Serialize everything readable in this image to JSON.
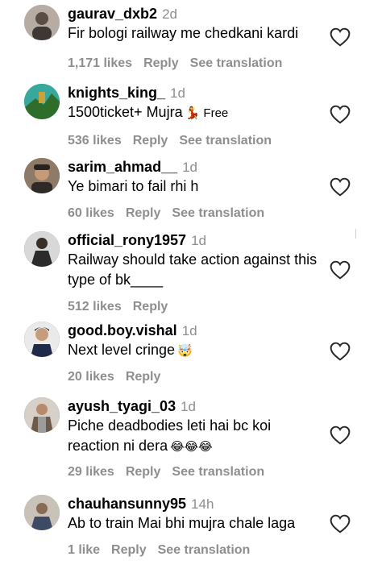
{
  "comments": [
    {
      "username": "gaurav_dxb2",
      "time": "2d",
      "text": "Fir bologi railway me chedkani kardi",
      "emoji": "",
      "likes": "1,171 likes",
      "reply": "Reply",
      "translate": "See translation",
      "avatar_color": "#9a8f86"
    },
    {
      "username": "knights_king_",
      "time": "1d",
      "text": "1500ticket+ Mujra",
      "emoji": "💃 Free",
      "likes": "536 likes",
      "reply": "Reply",
      "translate": "See translation",
      "avatar_color": "#3aa7a0"
    },
    {
      "username": "sarim_ahmad__",
      "time": "1d",
      "text": "Ye bimari to fail rhi h",
      "emoji": "",
      "likes": "60 likes",
      "reply": "Reply",
      "translate": "See translation",
      "avatar_color": "#7a6250"
    },
    {
      "username": "official_rony1957",
      "time": "1d",
      "text": "Railway should take action against this type of bk____",
      "emoji": "",
      "likes": "512 likes",
      "reply": "Reply",
      "translate": "",
      "avatar_color": "#4d4d4d"
    },
    {
      "username": "good.boy.vishal",
      "time": "1d",
      "text": "Next level cringe",
      "emoji": "🤯",
      "likes": "20 likes",
      "reply": "Reply",
      "translate": "",
      "avatar_color": "#3b3b3b"
    },
    {
      "username": "ayush_tyagi_03",
      "time": "1d",
      "text": "Piche deadbodies leti hai bc koi reaction ni dera",
      "emoji": "😂😂😂",
      "likes": "29 likes",
      "reply": "Reply",
      "translate": "See translation",
      "avatar_color": "#6d5a49"
    },
    {
      "username": "chauhansunny95",
      "time": "14h",
      "text": "Ab to train Mai bhi mujra chale laga",
      "emoji": "",
      "likes": "1 like",
      "reply": "Reply",
      "translate": "See translation",
      "avatar_color": "#8a7f75"
    }
  ]
}
